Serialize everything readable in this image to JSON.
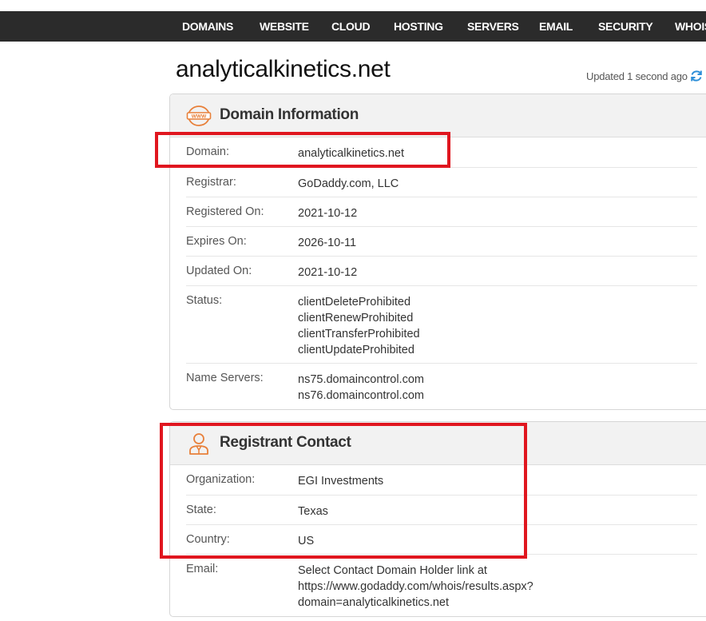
{
  "nav": {
    "items": [
      "DOMAINS",
      "WEBSITE",
      "CLOUD",
      "HOSTING",
      "SERVERS",
      "EMAIL",
      "SECURITY",
      "WHOIS"
    ]
  },
  "page": {
    "domain_title": "analyticalkinetics.net",
    "updated_text": "Updated 1 second ago"
  },
  "domain_info": {
    "title": "Domain Information",
    "icon": "www-icon",
    "rows": [
      {
        "label": "Domain:",
        "values": [
          "analyticalkinetics.net"
        ]
      },
      {
        "label": "Registrar:",
        "values": [
          "GoDaddy.com, LLC"
        ]
      },
      {
        "label": "Registered On:",
        "values": [
          "2021-10-12"
        ]
      },
      {
        "label": "Expires On:",
        "values": [
          "2026-10-11"
        ]
      },
      {
        "label": "Updated On:",
        "values": [
          "2021-10-12"
        ]
      },
      {
        "label": "Status:",
        "values": [
          "clientDeleteProhibited",
          "clientRenewProhibited",
          "clientTransferProhibited",
          "clientUpdateProhibited"
        ]
      },
      {
        "label": "Name Servers:",
        "values": [
          "ns75.domaincontrol.com",
          "ns76.domaincontrol.com"
        ]
      }
    ]
  },
  "registrant": {
    "title": "Registrant Contact",
    "icon": "person-icon",
    "rows": [
      {
        "label": "Organization:",
        "values": [
          "EGI Investments"
        ]
      },
      {
        "label": "State:",
        "values": [
          "Texas"
        ]
      },
      {
        "label": "Country:",
        "values": [
          "US"
        ]
      },
      {
        "label": "Email:",
        "values": [
          "Select Contact Domain Holder link at",
          "https://www.godaddy.com/whois/results.aspx?",
          "domain=analyticalkinetics.net"
        ]
      }
    ]
  },
  "colors": {
    "nav_bg": "#2b2b2b",
    "accent_orange": "#e8803a",
    "highlight_red": "#e0161f",
    "refresh_blue": "#2f8fd8"
  }
}
